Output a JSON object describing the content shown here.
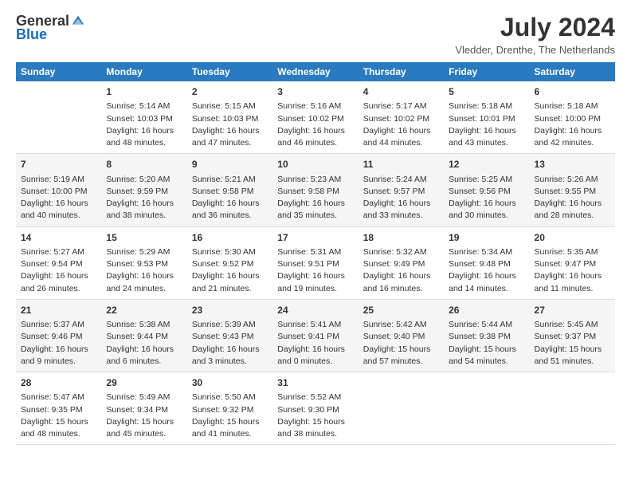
{
  "header": {
    "logo_general": "General",
    "logo_blue": "Blue",
    "month_title": "July 2024",
    "location": "Vledder, Drenthe, The Netherlands"
  },
  "days_of_week": [
    "Sunday",
    "Monday",
    "Tuesday",
    "Wednesday",
    "Thursday",
    "Friday",
    "Saturday"
  ],
  "weeks": [
    [
      {
        "day": "",
        "text": ""
      },
      {
        "day": "1",
        "text": "Sunrise: 5:14 AM\nSunset: 10:03 PM\nDaylight: 16 hours\nand 48 minutes."
      },
      {
        "day": "2",
        "text": "Sunrise: 5:15 AM\nSunset: 10:03 PM\nDaylight: 16 hours\nand 47 minutes."
      },
      {
        "day": "3",
        "text": "Sunrise: 5:16 AM\nSunset: 10:02 PM\nDaylight: 16 hours\nand 46 minutes."
      },
      {
        "day": "4",
        "text": "Sunrise: 5:17 AM\nSunset: 10:02 PM\nDaylight: 16 hours\nand 44 minutes."
      },
      {
        "day": "5",
        "text": "Sunrise: 5:18 AM\nSunset: 10:01 PM\nDaylight: 16 hours\nand 43 minutes."
      },
      {
        "day": "6",
        "text": "Sunrise: 5:18 AM\nSunset: 10:00 PM\nDaylight: 16 hours\nand 42 minutes."
      }
    ],
    [
      {
        "day": "7",
        "text": "Sunrise: 5:19 AM\nSunset: 10:00 PM\nDaylight: 16 hours\nand 40 minutes."
      },
      {
        "day": "8",
        "text": "Sunrise: 5:20 AM\nSunset: 9:59 PM\nDaylight: 16 hours\nand 38 minutes."
      },
      {
        "day": "9",
        "text": "Sunrise: 5:21 AM\nSunset: 9:58 PM\nDaylight: 16 hours\nand 36 minutes."
      },
      {
        "day": "10",
        "text": "Sunrise: 5:23 AM\nSunset: 9:58 PM\nDaylight: 16 hours\nand 35 minutes."
      },
      {
        "day": "11",
        "text": "Sunrise: 5:24 AM\nSunset: 9:57 PM\nDaylight: 16 hours\nand 33 minutes."
      },
      {
        "day": "12",
        "text": "Sunrise: 5:25 AM\nSunset: 9:56 PM\nDaylight: 16 hours\nand 30 minutes."
      },
      {
        "day": "13",
        "text": "Sunrise: 5:26 AM\nSunset: 9:55 PM\nDaylight: 16 hours\nand 28 minutes."
      }
    ],
    [
      {
        "day": "14",
        "text": "Sunrise: 5:27 AM\nSunset: 9:54 PM\nDaylight: 16 hours\nand 26 minutes."
      },
      {
        "day": "15",
        "text": "Sunrise: 5:29 AM\nSunset: 9:53 PM\nDaylight: 16 hours\nand 24 minutes."
      },
      {
        "day": "16",
        "text": "Sunrise: 5:30 AM\nSunset: 9:52 PM\nDaylight: 16 hours\nand 21 minutes."
      },
      {
        "day": "17",
        "text": "Sunrise: 5:31 AM\nSunset: 9:51 PM\nDaylight: 16 hours\nand 19 minutes."
      },
      {
        "day": "18",
        "text": "Sunrise: 5:32 AM\nSunset: 9:49 PM\nDaylight: 16 hours\nand 16 minutes."
      },
      {
        "day": "19",
        "text": "Sunrise: 5:34 AM\nSunset: 9:48 PM\nDaylight: 16 hours\nand 14 minutes."
      },
      {
        "day": "20",
        "text": "Sunrise: 5:35 AM\nSunset: 9:47 PM\nDaylight: 16 hours\nand 11 minutes."
      }
    ],
    [
      {
        "day": "21",
        "text": "Sunrise: 5:37 AM\nSunset: 9:46 PM\nDaylight: 16 hours\nand 9 minutes."
      },
      {
        "day": "22",
        "text": "Sunrise: 5:38 AM\nSunset: 9:44 PM\nDaylight: 16 hours\nand 6 minutes."
      },
      {
        "day": "23",
        "text": "Sunrise: 5:39 AM\nSunset: 9:43 PM\nDaylight: 16 hours\nand 3 minutes."
      },
      {
        "day": "24",
        "text": "Sunrise: 5:41 AM\nSunset: 9:41 PM\nDaylight: 16 hours\nand 0 minutes."
      },
      {
        "day": "25",
        "text": "Sunrise: 5:42 AM\nSunset: 9:40 PM\nDaylight: 15 hours\nand 57 minutes."
      },
      {
        "day": "26",
        "text": "Sunrise: 5:44 AM\nSunset: 9:38 PM\nDaylight: 15 hours\nand 54 minutes."
      },
      {
        "day": "27",
        "text": "Sunrise: 5:45 AM\nSunset: 9:37 PM\nDaylight: 15 hours\nand 51 minutes."
      }
    ],
    [
      {
        "day": "28",
        "text": "Sunrise: 5:47 AM\nSunset: 9:35 PM\nDaylight: 15 hours\nand 48 minutes."
      },
      {
        "day": "29",
        "text": "Sunrise: 5:49 AM\nSunset: 9:34 PM\nDaylight: 15 hours\nand 45 minutes."
      },
      {
        "day": "30",
        "text": "Sunrise: 5:50 AM\nSunset: 9:32 PM\nDaylight: 15 hours\nand 41 minutes."
      },
      {
        "day": "31",
        "text": "Sunrise: 5:52 AM\nSunset: 9:30 PM\nDaylight: 15 hours\nand 38 minutes."
      },
      {
        "day": "",
        "text": ""
      },
      {
        "day": "",
        "text": ""
      },
      {
        "day": "",
        "text": ""
      }
    ]
  ]
}
